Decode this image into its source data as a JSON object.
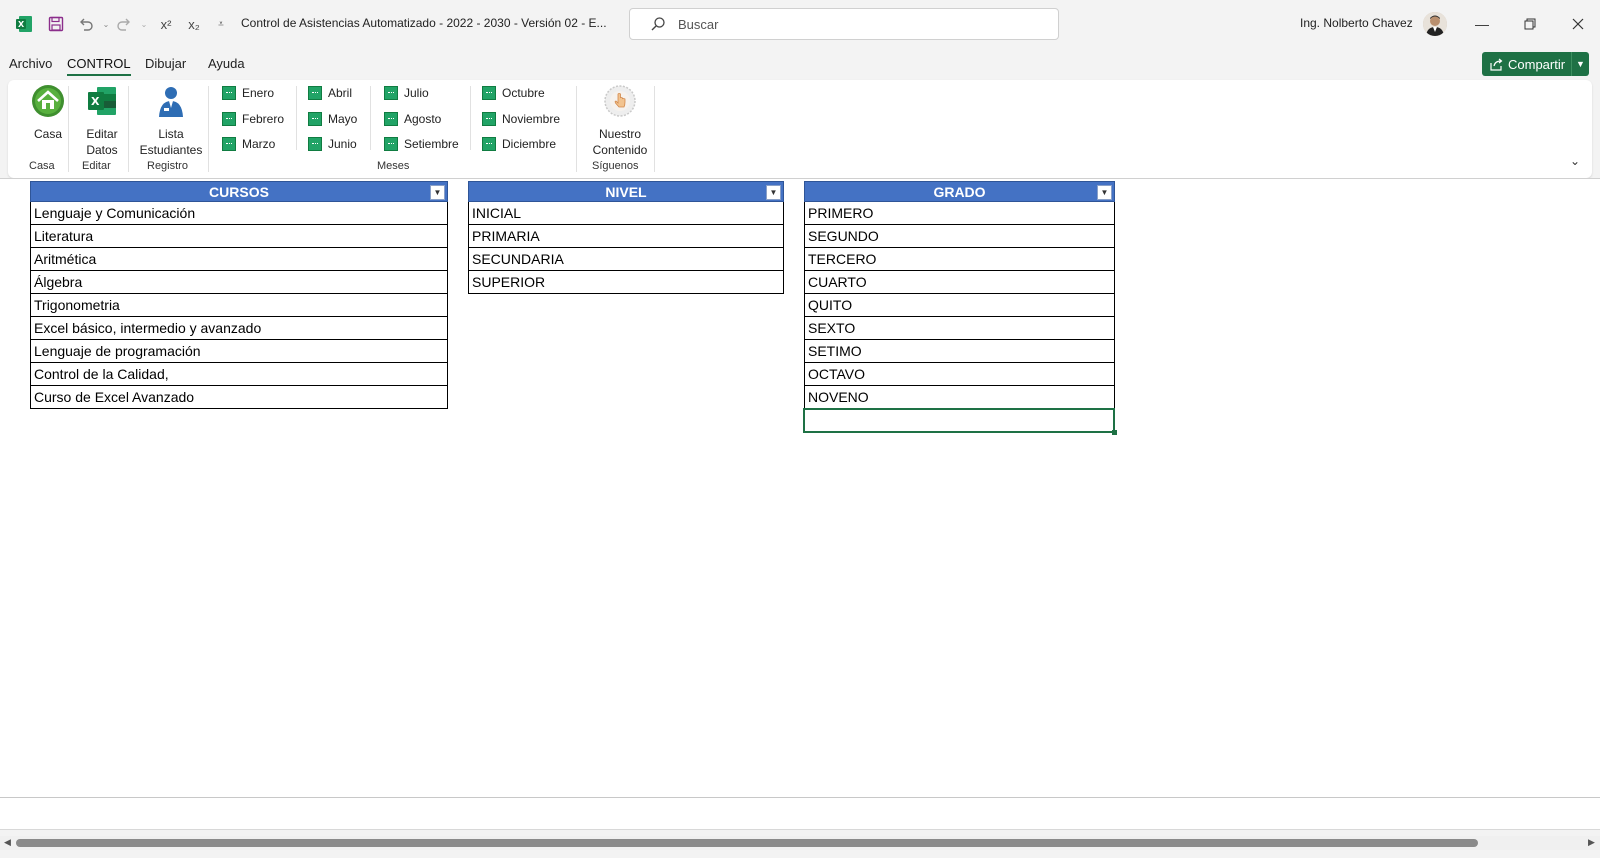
{
  "window": {
    "title": "Control de Asistencias Automatizado - 2022 - 2030 - Versión 02  -  E...",
    "search_placeholder": "Buscar",
    "user_name": "Ing. Nolberto Chavez",
    "quick_access": {
      "superscript": "x²",
      "subscript": "x₂"
    }
  },
  "menu": {
    "tabs": [
      {
        "label": "Archivo"
      },
      {
        "label": "CONTROL",
        "active": true
      },
      {
        "label": "Dibujar"
      },
      {
        "label": "Ayuda"
      }
    ],
    "share_label": "Compartir"
  },
  "ribbon": {
    "casa": {
      "button": "Casa",
      "group": "Casa"
    },
    "editar": {
      "button_line1": "Editar",
      "button_line2": "Datos",
      "group": "Editar"
    },
    "registro": {
      "button_line1": "Lista",
      "button_line2": "Estudiantes",
      "group": "Registro"
    },
    "meses": {
      "group": "Meses",
      "items": [
        "Enero",
        "Febrero",
        "Marzo",
        "Abril",
        "Mayo",
        "Junio",
        "Julio",
        "Agosto",
        "Setiembre",
        "Octubre",
        "Noviembre",
        "Diciembre"
      ]
    },
    "siguenos": {
      "button_line1": "Nuestro",
      "button_line2": "Contenido",
      "group": "Síguenos"
    }
  },
  "tables": {
    "cursos": {
      "header": "CURSOS",
      "rows": [
        "Lenguaje y Comunicación",
        "Literatura",
        "Aritmética",
        "Álgebra",
        "Trigonometria",
        "Excel básico, intermedio y avanzado",
        "Lenguaje de programación",
        "Control de la Calidad,",
        "Curso de Excel Avanzado"
      ]
    },
    "nivel": {
      "header": "NIVEL",
      "rows": [
        "INICIAL",
        "PRIMARIA",
        "SECUNDARIA",
        "SUPERIOR"
      ]
    },
    "grado": {
      "header": "GRADO",
      "rows": [
        "PRIMERO",
        "SEGUNDO",
        "TERCERO",
        "CUARTO",
        "QUITO",
        "SEXTO",
        "SETIMO",
        "OCTAVO",
        "NOVENO"
      ]
    }
  },
  "colors": {
    "accent": "#1e7145",
    "table_header": "#4472c4"
  }
}
